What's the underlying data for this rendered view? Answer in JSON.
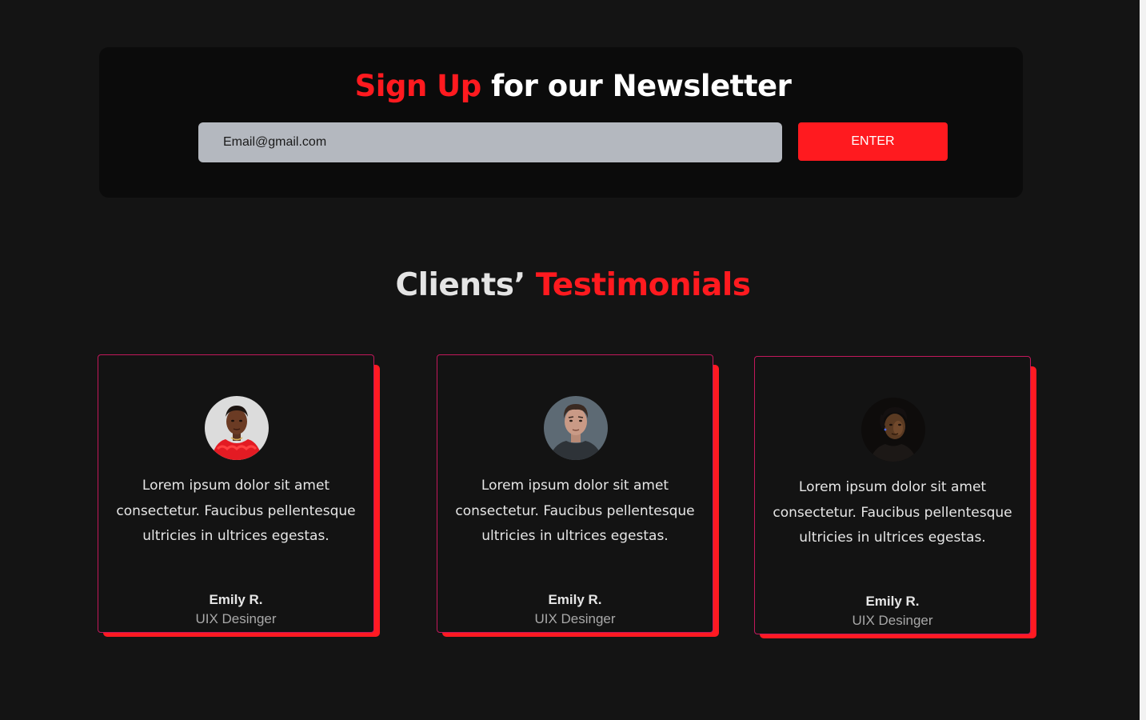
{
  "newsletter": {
    "title_accent": "Sign Up",
    "title_rest": " for our Newsletter",
    "email_placeholder": "Email@gmail.com",
    "button_label": "ENTER"
  },
  "testimonials": {
    "title_plain": "Clients’ ",
    "title_accent": "Testimonials",
    "items": [
      {
        "quote": "Lorem ipsum dolor sit amet consectetur. Faucibus pellentesque ultricies in ultrices egestas.",
        "name": "Emily R.",
        "role": "UIX Desinger"
      },
      {
        "quote": "Lorem ipsum dolor sit amet consectetur. Faucibus pellentesque ultricies in ultrices egestas.",
        "name": "Emily R.",
        "role": "UIX Desinger"
      },
      {
        "quote": "Lorem ipsum dolor sit amet consectetur. Faucibus pellentesque ultricies in ultrices egestas.",
        "name": "Emily R.",
        "role": "UIX Desinger"
      }
    ]
  },
  "colors": {
    "background": "#141414",
    "panel": "#0b0b0b",
    "accent": "#ff1a1f",
    "card_border": "#c2185b",
    "input_bg": "#b4b8bf"
  }
}
